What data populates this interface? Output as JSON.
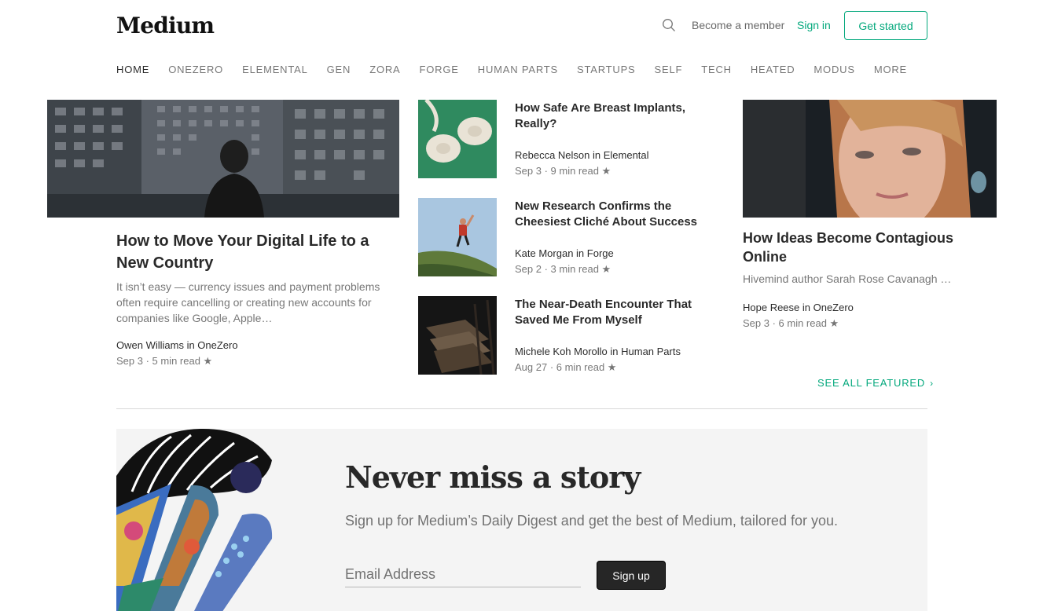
{
  "header": {
    "logo": "Medium",
    "search_icon": "search-icon",
    "become_member": "Become a member",
    "sign_in": "Sign in",
    "get_started": "Get started"
  },
  "nav": {
    "items": [
      "HOME",
      "ONEZERO",
      "ELEMENTAL",
      "GEN",
      "ZORA",
      "FORGE",
      "HUMAN PARTS",
      "STARTUPS",
      "SELF",
      "TECH",
      "HEATED",
      "MODUS",
      "MORE"
    ],
    "active": "HOME"
  },
  "featured": {
    "title": "How to Move Your Digital Life to a New Country",
    "excerpt": "It isn’t easy — currency issues and payment problems often require cancelling or creating new accounts for companies like Google, Apple…",
    "author_line": "Owen Williams in OneZero",
    "meta": "Sep 3 · 5 min read ★"
  },
  "middle": [
    {
      "title": "How Safe Are Breast Implants, Really?",
      "author_line": "Rebecca Nelson in Elemental",
      "meta": "Sep 3 · 9 min read ★"
    },
    {
      "title": "New Research Confirms the Cheesiest Cliché About Success",
      "author_line": "Kate Morgan in Forge",
      "meta": "Sep 2 · 3 min read ★"
    },
    {
      "title": "The Near-Death Encounter That Saved Me From Myself",
      "author_line": "Michele Koh Morollo in Human Parts",
      "meta": "Aug 27 · 6 min read ★"
    }
  ],
  "right": {
    "title": "How Ideas Become Contagious Online",
    "excerpt": "Hivemind author Sarah Rose Cavanagh …",
    "author_line": "Hope Reese in OneZero",
    "meta": "Sep 3 · 6 min read ★"
  },
  "see_all": {
    "label": "SEE ALL FEATURED",
    "icon": "chevron-right-icon"
  },
  "digest": {
    "title": "Never miss a story",
    "subtitle": "Sign up for Medium’s Daily Digest and get the best of Medium, tailored for you.",
    "email_placeholder": "Email Address",
    "button": "Sign up"
  },
  "colors": {
    "accent": "#03a87c",
    "button_dark": "#262626",
    "digest_bg": "#f4f4f4"
  }
}
